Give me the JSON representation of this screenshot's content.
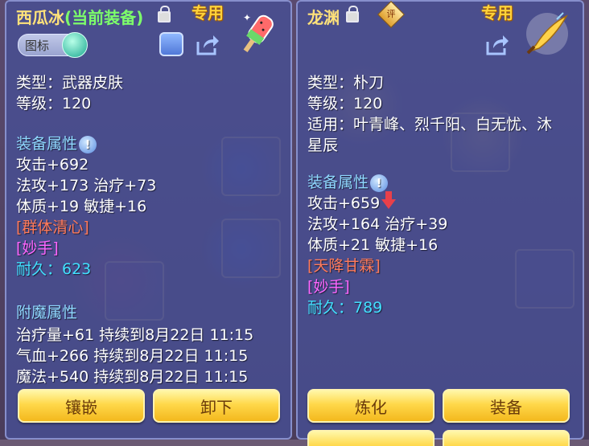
{
  "left": {
    "name": "西瓜冰",
    "name_suffix": "(当前装备)",
    "exclusive": "专用",
    "icon_tag": "图标",
    "lines": [
      {
        "text": "类型：武器皮肤",
        "cls": ""
      },
      {
        "text": "等级：120",
        "cls": ""
      }
    ],
    "attr_title": "装备属性",
    "attrs": [
      {
        "text": "攻击+692",
        "cls": ""
      },
      {
        "text": "法攻+173 治疗+73",
        "cls": ""
      },
      {
        "text": "体质+19 敏捷+16",
        "cls": ""
      },
      {
        "text": "[群体清心]",
        "cls": "red"
      },
      {
        "text": "[妙手]",
        "cls": "purple"
      },
      {
        "text": "耐久：623",
        "cls": "cyan"
      }
    ],
    "enchant_title": "附魔属性",
    "enchants": [
      "治疗量+61 持续到8月22日 11:15",
      "气血+266 持续到8月22日 11:15",
      "魔法+540 持续到8月22日 11:15"
    ],
    "buttons": [
      "镶嵌",
      "卸下"
    ]
  },
  "right": {
    "name": "龙渊",
    "rate_label": "评",
    "exclusive": "专用",
    "lines": [
      {
        "text": "类型：朴刀",
        "cls": ""
      },
      {
        "text": "等级：120",
        "cls": ""
      },
      {
        "text": "适用：叶青峰、烈千阳、白无忧、沐",
        "cls": ""
      },
      {
        "text": "星辰",
        "cls": ""
      }
    ],
    "attr_title": "装备属性",
    "attrs": [
      {
        "text": "攻击+659",
        "cls": ""
      },
      {
        "text": "法攻+164 治疗+39",
        "cls": ""
      },
      {
        "text": "体质+21 敏捷+16",
        "cls": ""
      },
      {
        "text": "[天降甘霖]",
        "cls": "red"
      },
      {
        "text": "[妙手]",
        "cls": "purple"
      },
      {
        "text": "耐久：789",
        "cls": "cyan"
      }
    ],
    "buttons": [
      "炼化",
      "装备"
    ]
  },
  "colors": {
    "name_green": "#7dff6a",
    "name_gold": "#ffe27a",
    "section": "#8fd8ff",
    "down_arrow": "#e8404a"
  }
}
